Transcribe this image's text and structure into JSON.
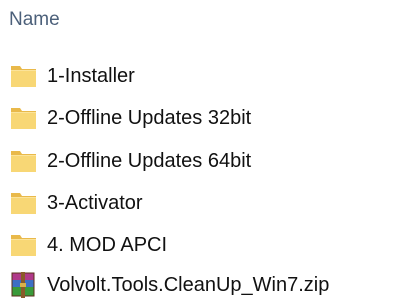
{
  "header": {
    "name_column": "Name"
  },
  "files": [
    {
      "name": "1-Installer",
      "type": "folder"
    },
    {
      "name": "2-Offline Updates 32bit",
      "type": "folder"
    },
    {
      "name": "2-Offline Updates 64bit",
      "type": "folder"
    },
    {
      "name": "3-Activator",
      "type": "folder"
    },
    {
      "name": "4. MOD APCI",
      "type": "folder"
    },
    {
      "name": "Volvolt.Tools.CleanUp_Win7.zip",
      "type": "zip-archive"
    }
  ],
  "colors": {
    "header_text": "#4c607a",
    "folder_fill": "#f8d775",
    "folder_tab": "#e9b94a",
    "text": "#111111"
  }
}
